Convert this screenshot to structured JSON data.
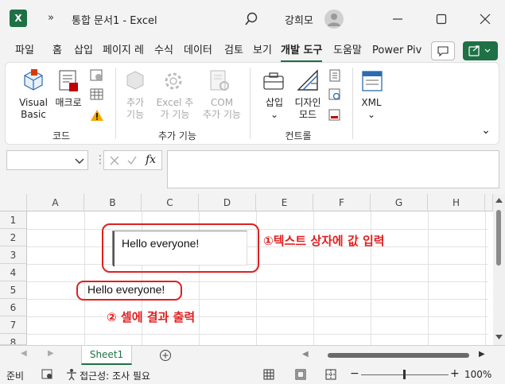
{
  "titlebar": {
    "app_icon_letter": "X",
    "overflow": "»",
    "doc_title": "통합 문서1  -  Excel",
    "user_name": "강희모"
  },
  "tabs": [
    "파일",
    "홈",
    "삽입",
    "페이지 레",
    "수식",
    "데이터",
    "검토",
    "보기",
    "개발 도구",
    "도움말",
    "Power Piv"
  ],
  "active_tab": "개발 도구",
  "ribbon": {
    "code": {
      "visual_basic": [
        "Visual",
        "Basic"
      ],
      "macro": "매크로",
      "label": "코드"
    },
    "addins": {
      "addins": [
        "추가",
        "기능"
      ],
      "excel_addins": [
        "Excel 추",
        "가 기능"
      ],
      "com_addins": [
        "COM",
        "추가 기능"
      ],
      "label": "추가 기능"
    },
    "controls": {
      "insert": "삽입",
      "design_mode": [
        "디자인",
        "모드"
      ],
      "label": "컨트롤"
    },
    "xml": {
      "xml": "XML"
    }
  },
  "formula_bar": {
    "name_box": "",
    "fx": "fx",
    "content": ""
  },
  "grid": {
    "columns": [
      "A",
      "B",
      "C",
      "D",
      "E",
      "F",
      "G",
      "H"
    ],
    "rows": [
      "1",
      "2",
      "3",
      "4",
      "5",
      "6",
      "7",
      "8"
    ],
    "textbox_text": "Hello everyone!",
    "cell_b5": "Hello everyone!"
  },
  "annotations": {
    "a1": "①텍스트 상자에 값 입력",
    "a2": "② 셀에 결과 출력"
  },
  "sheets": {
    "tab": "Sheet1"
  },
  "status": {
    "ready": "준비",
    "accessibility": "접근성: 조사 필요",
    "zoom": "100%"
  },
  "colors": {
    "excel_green": "#1e7145",
    "annotation_red": "#e02020"
  }
}
